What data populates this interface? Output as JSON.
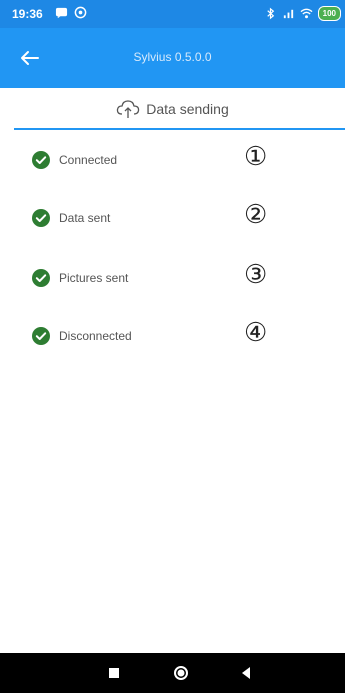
{
  "status_bar": {
    "time": "19:36",
    "battery": "100"
  },
  "app_bar": {
    "title": "Sylvius 0.5.0.0"
  },
  "section": {
    "title": "Data sending"
  },
  "steps": [
    {
      "label": "Connected",
      "number": "①",
      "status": "done"
    },
    {
      "label": "Data sent",
      "number": "②",
      "status": "done"
    },
    {
      "label": "Pictures sent",
      "number": "③",
      "status": "done"
    },
    {
      "label": "Disconnected",
      "number": "④",
      "status": "done"
    }
  ],
  "colors": {
    "status_bar": "#1e88e5",
    "app_bar": "#2196f3",
    "check": "#2e7d32",
    "accent_line": "#2196f3"
  },
  "icons": {
    "back": "arrow-left-icon",
    "cloud": "cloud-upload-icon",
    "check": "check-circle-icon",
    "nav": [
      "recents-icon",
      "home-icon",
      "back-triangle-icon"
    ]
  }
}
